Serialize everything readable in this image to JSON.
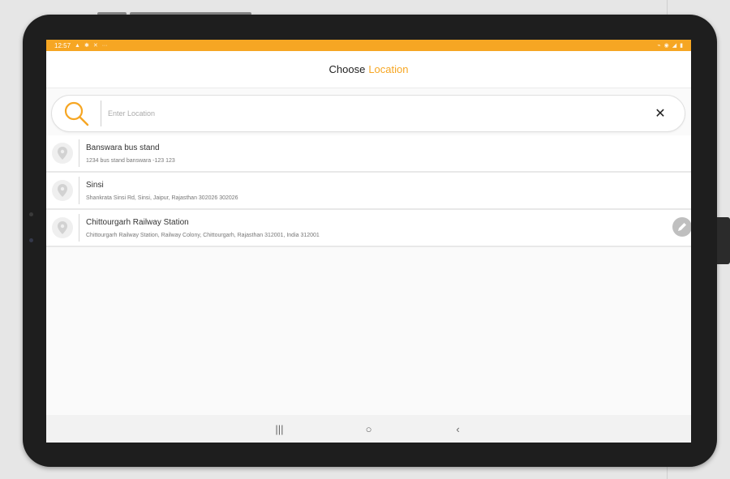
{
  "status_bar": {
    "time": "12:57",
    "left_icons": [
      "android-icon",
      "bluetooth-icon",
      "settings-icon",
      "dots-icon"
    ],
    "right_icons": [
      "wifi-icon",
      "alarm-icon",
      "signal-icon",
      "battery-icon"
    ],
    "accent": "#f6a623"
  },
  "header": {
    "title_primary": "Choose",
    "title_accent": "Location"
  },
  "search": {
    "placeholder": "Enter Location",
    "value": ""
  },
  "locations": [
    {
      "title": "Banswara bus stand",
      "subtitle": "1234 bus stand banswara -123 123"
    },
    {
      "title": "Sinsi",
      "subtitle": "Shankrata Sinsi Rd, Sinsi, Jaipur, Rajasthan 302026 302026"
    },
    {
      "title": "Chittourgarh Railway Station",
      "subtitle": "Chittourgarh Railway Station, Railway Colony, Chittourgarh, Rajasthan 312001, India 312001"
    }
  ],
  "nav": {
    "recent_label": "|||",
    "home_label": "○",
    "back_label": "‹"
  }
}
